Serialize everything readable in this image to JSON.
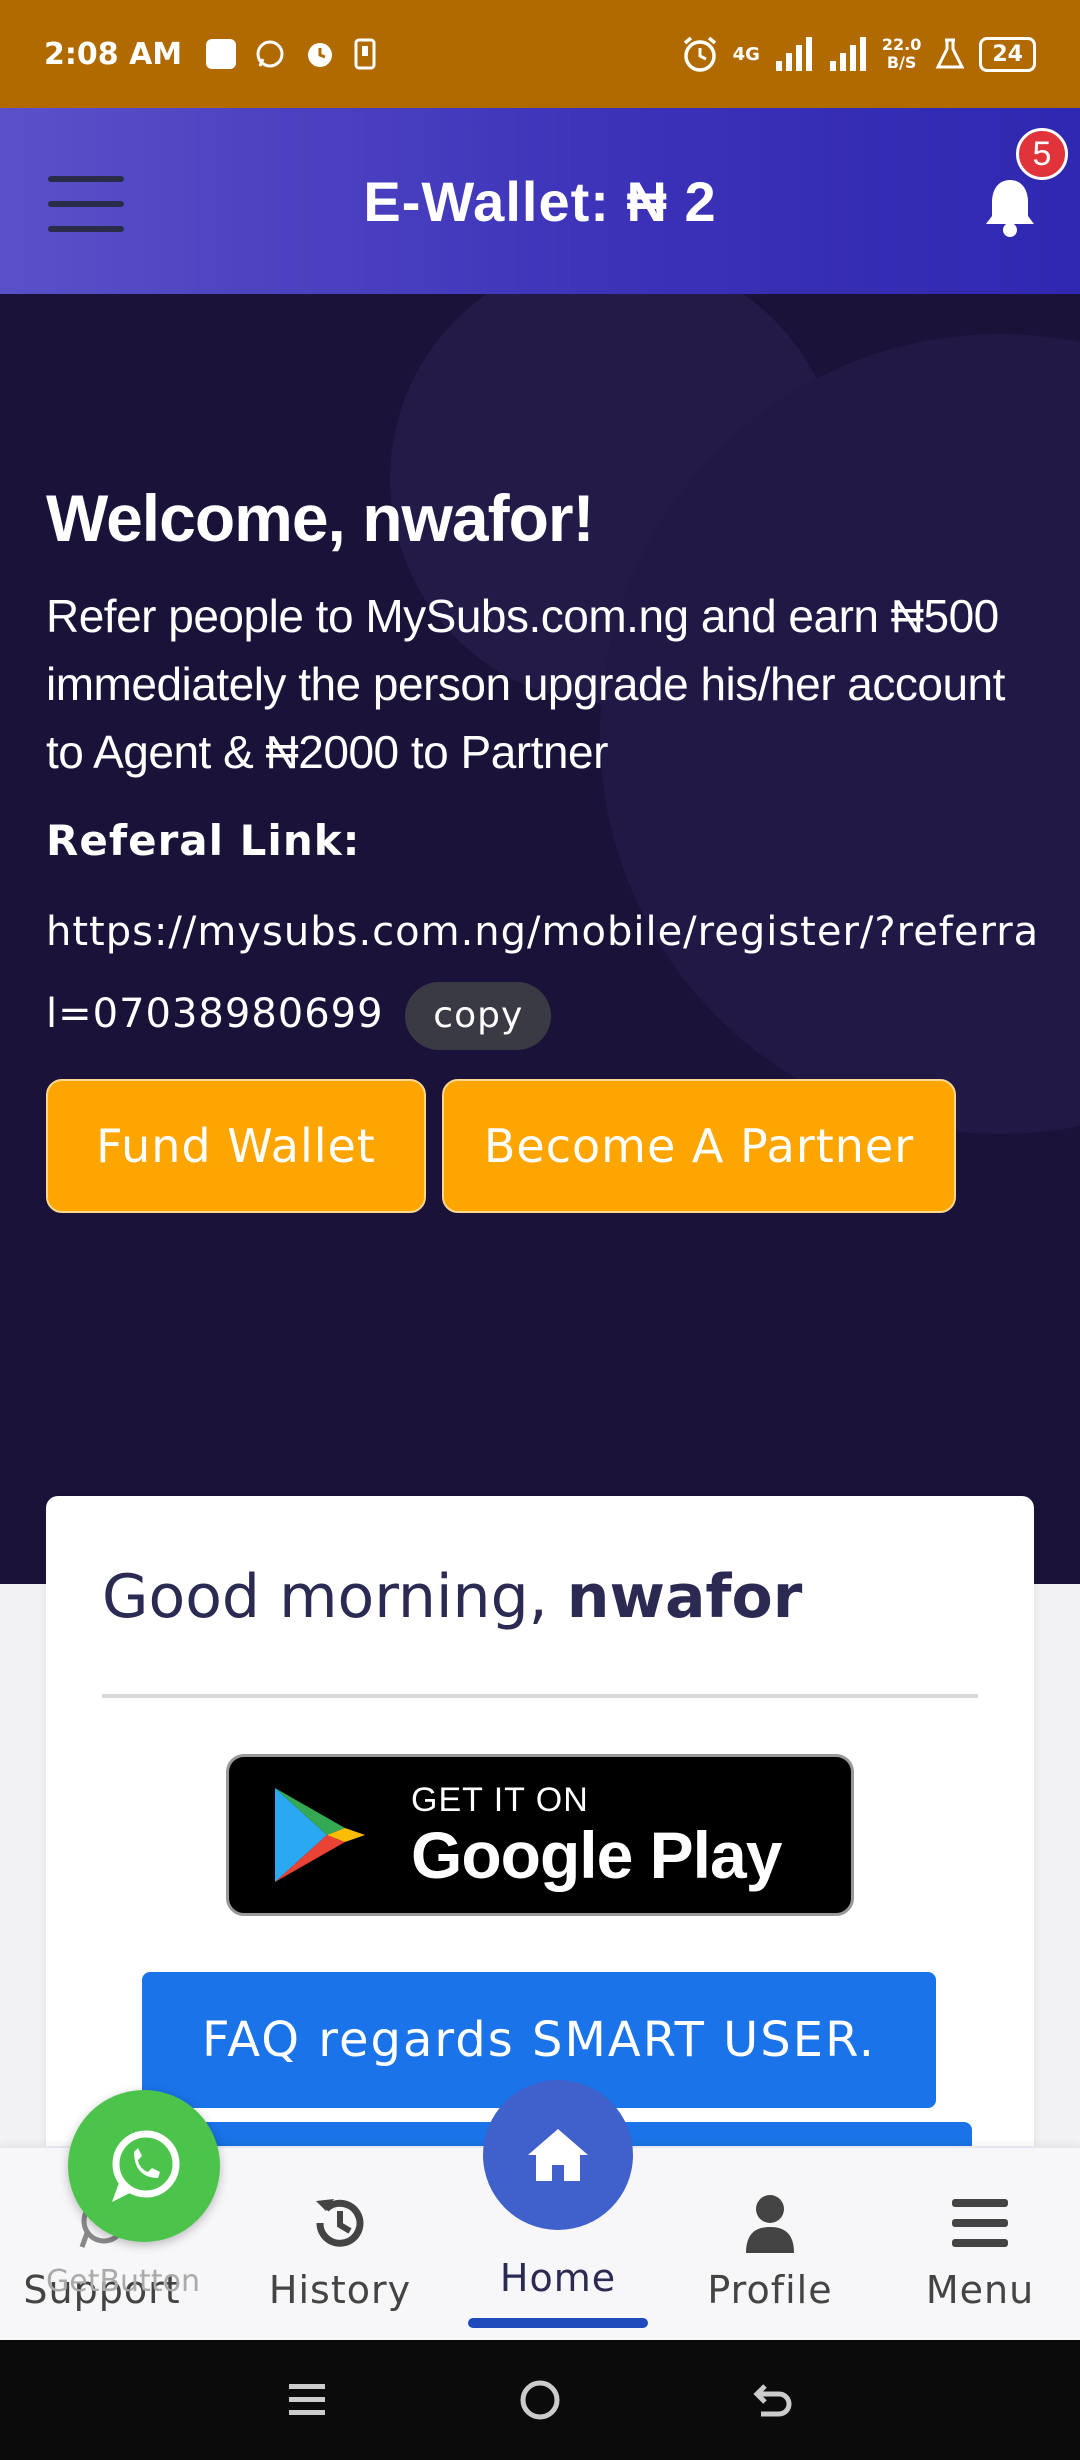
{
  "status_bar": {
    "time": "2:08 AM",
    "network": "4G",
    "speed": "22.0",
    "speed_unit": "B/S",
    "battery": "24"
  },
  "header": {
    "title": "E-Wallet: ₦ 2",
    "notification_count": "5"
  },
  "hero": {
    "welcome": "Welcome, nwafor!",
    "refer_text": "Refer people to MySubs.com.ng and earn ₦500 immediately the person upgrade his/her account to Agent & ₦2000 to Partner",
    "referral_label": "Referal Link:",
    "referral_link": "https://mysubs.com.ng/mobile/register/?referral=07038980699",
    "copy_label": "copy",
    "fund_wallet_label": "Fund Wallet",
    "become_partner_label": "Become A Partner"
  },
  "card": {
    "greeting_prefix": "Good morning, ",
    "greeting_name": "nwafor",
    "gplay_small": "GET IT ON",
    "gplay_big": "Google Play",
    "faq_label": "FAQ regards SMART USER."
  },
  "bottom_nav": {
    "items": [
      {
        "label": "Support",
        "icon": "whatsapp-icon"
      },
      {
        "label": "History",
        "icon": "history-icon"
      },
      {
        "label": "Home",
        "icon": "home-icon"
      },
      {
        "label": "Profile",
        "icon": "person-icon"
      },
      {
        "label": "Menu",
        "icon": "menu-icon"
      }
    ],
    "getbutton_text": "GetButton"
  },
  "colors": {
    "status_bar": "#b06a00",
    "header_gradient_start": "#5a50c8",
    "hero_bg": "#1a1238",
    "orange": "#ffa500",
    "blue_button": "#1a73e8",
    "home_fab": "#4060cc",
    "whatsapp_green": "#4cc44c"
  }
}
